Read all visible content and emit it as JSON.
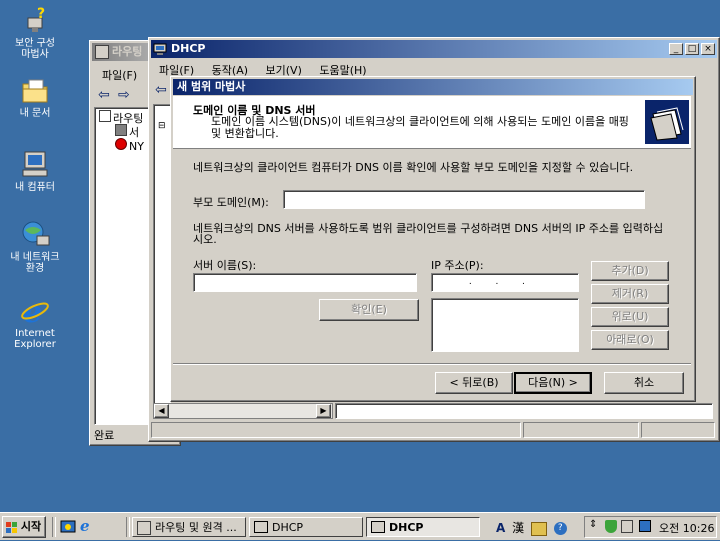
{
  "desktop": {
    "icons": [
      {
        "label": "보안 구성 마법사",
        "icon": "security-wizard-icon"
      },
      {
        "label": "내 문서",
        "icon": "my-documents-icon"
      },
      {
        "label": "내 컴퓨터",
        "icon": "my-computer-icon"
      },
      {
        "label": "내 네트워크 환경",
        "icon": "network-places-icon"
      },
      {
        "label": "Internet Explorer",
        "icon": "internet-explorer-icon"
      }
    ]
  },
  "routing_window": {
    "title": "라우팅",
    "menu_file": "파일(F)",
    "tree_root": "라우팅",
    "tree_item1": "서",
    "tree_item2": "NY",
    "status": "완료"
  },
  "dhcp_window": {
    "title": "DHCP",
    "menu": [
      "파일(F)",
      "동작(A)",
      "보기(V)",
      "도움말(H)"
    ]
  },
  "wizard": {
    "title": "새 범위 마법사",
    "header_title": "도메인 이름 및 DNS 서버",
    "header_desc": "도메인 이름 시스템(DNS)이 네트워크상의 클라이언트에 의해 사용되는 도메인 이름을 매핑 및 변환합니다.",
    "intro": "네트워크상의 클라이언트 컴퓨터가 DNS 이름 확인에 사용할 부모 도메인을 지정할 수 있습니다.",
    "parent_domain_label": "부모 도메인(M):",
    "parent_domain_value": "",
    "dns_desc": "네트워크상의 DNS 서버를 사용하도록 범위 클라이언트를 구성하려면 DNS 서버의 IP 주소를 입력하십시오.",
    "server_name_label": "서버 이름(S):",
    "server_name_value": "",
    "ip_label": "IP 주소(P):",
    "ip_value": " .  .  . ",
    "resolve_button": "확인(E)",
    "add_button": "추가(D)",
    "remove_button": "제거(R)",
    "up_button": "위로(U)",
    "down_button": "아래로(O)",
    "back_button": "< 뒤로(B)",
    "next_button": "다음(N) >",
    "cancel_button": "취소"
  },
  "taskbar": {
    "start": "시작",
    "tasks": [
      "라우팅 및 원격 ...",
      "DHCP",
      "DHCP"
    ],
    "ime_a": "A",
    "ime_han": "漢",
    "clock": "오전 10:26"
  },
  "colors": {
    "desktop": "#3a6ea5",
    "title_active": "#0a246a",
    "face": "#d4d0c8"
  }
}
